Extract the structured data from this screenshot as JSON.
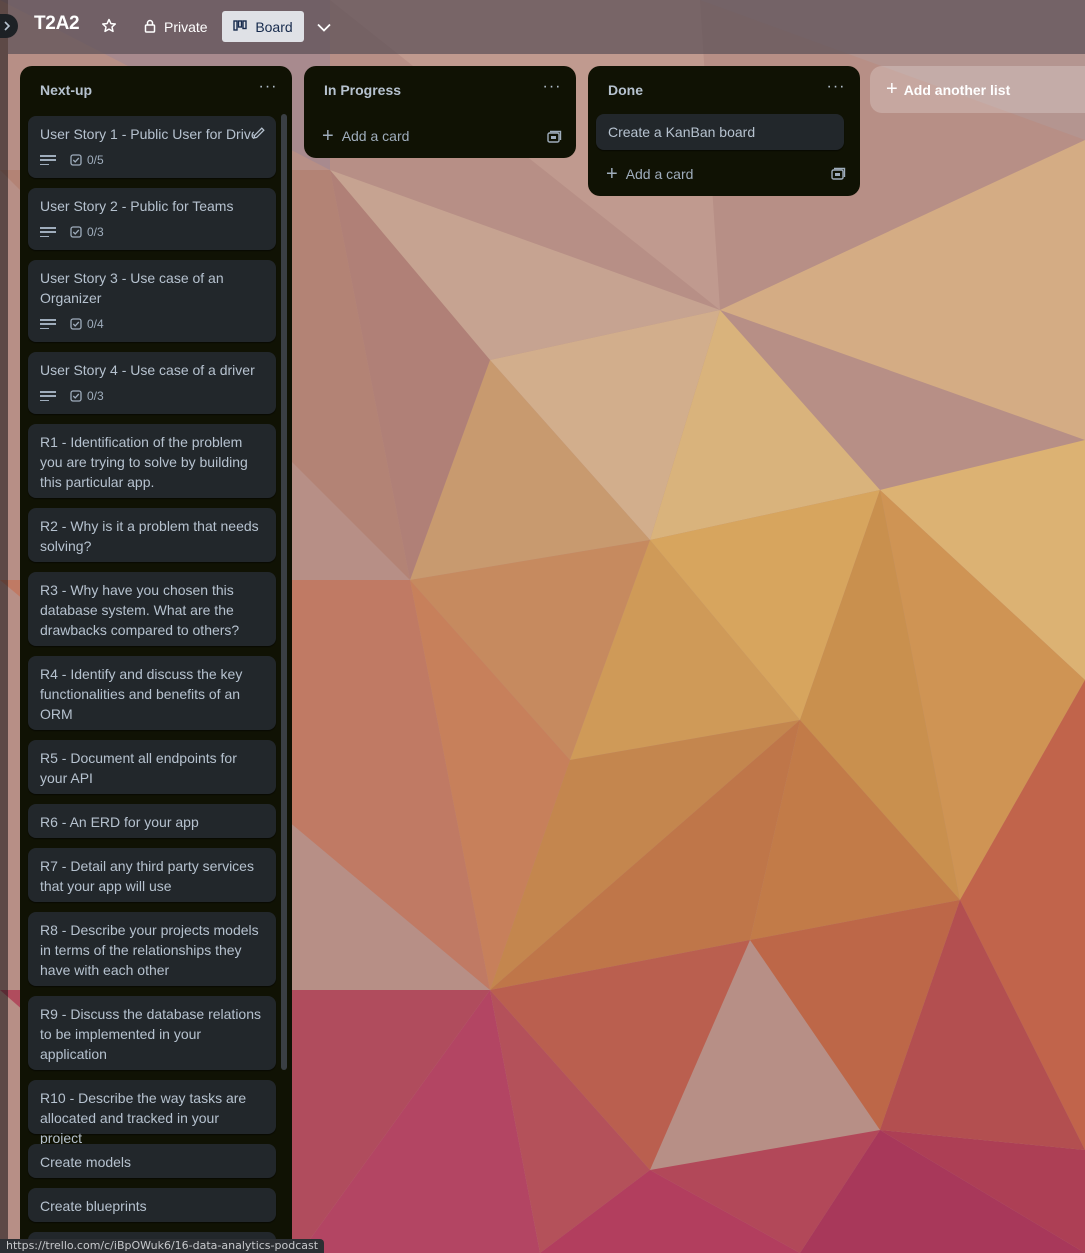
{
  "board": {
    "title": "T2A2",
    "visibility": "Private",
    "view": "Board"
  },
  "lists": {
    "next_up": {
      "title": "Next-up",
      "cards": [
        {
          "title": "User Story 1 - Public User for Drive",
          "checklist": "0/5"
        },
        {
          "title": "User Story 2 - Public for Teams",
          "checklist": "0/3"
        },
        {
          "title": "User Story 3 - Use case of an Organizer",
          "checklist": "0/4"
        },
        {
          "title": "User Story 4 - Use case of a driver",
          "checklist": "0/3"
        },
        {
          "title": "R1 - Identification of the problem you are trying to solve by building this particular app."
        },
        {
          "title": "R2 - Why is it a problem that needs solving?"
        },
        {
          "title": "R3 - Why have you chosen this database system. What are the drawbacks compared to others?"
        },
        {
          "title": "R4 - Identify and discuss the key functionalities and benefits of an ORM"
        },
        {
          "title": "R5 - Document all endpoints for your API"
        },
        {
          "title": "R6 - An ERD for your app"
        },
        {
          "title": "R7 - Detail any third party services that your app will use"
        },
        {
          "title": "R8 - Describe your projects models in terms of the relationships they have with each other"
        },
        {
          "title": "R9 - Discuss the database relations to be implemented in your application"
        },
        {
          "title": "R10 - Describe the way tasks are allocated and tracked in your project"
        },
        {
          "title": "Create models"
        },
        {
          "title": "Create blueprints"
        }
      ]
    },
    "in_progress": {
      "title": "In Progress",
      "add_card_label": "Add a card"
    },
    "done": {
      "title": "Done",
      "cards": [
        {
          "title": "Create a KanBan board"
        }
      ],
      "add_card_label": "Add a card"
    }
  },
  "add_list_label": "Add another list",
  "status_url": "https://trello.com/c/iBpOWuk6/16-data-analytics-podcast",
  "colors": {
    "list_bg": "#101204",
    "card_bg": "#22272b",
    "text": "#b6c2cf"
  },
  "icons": [
    "sidebar-expand-icon",
    "star-icon",
    "lock-icon",
    "board-icon",
    "chevron-down-icon",
    "more-icon",
    "edit-icon",
    "description-icon",
    "checklist-icon",
    "plus-icon",
    "card-template-icon"
  ]
}
